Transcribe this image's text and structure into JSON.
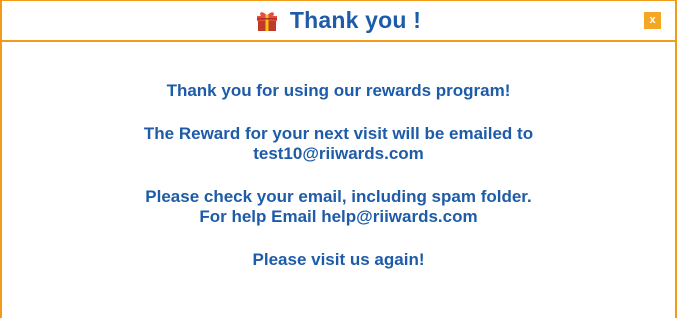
{
  "dialog": {
    "title": "Thank you !",
    "title_icon": "gift-icon",
    "close_label": "x",
    "accent_color": "#f29a1a",
    "text_color": "#1e5ba8"
  },
  "message": {
    "line1": "Thank you for using our rewards program!",
    "line2a": "The Reward for your next visit will be emailed to",
    "line2b": "test10@riiwards.com",
    "line3a": "Please check your email, including spam folder.",
    "line3b": "For help Email help@riiwards.com",
    "line4": "Please visit us again!"
  }
}
